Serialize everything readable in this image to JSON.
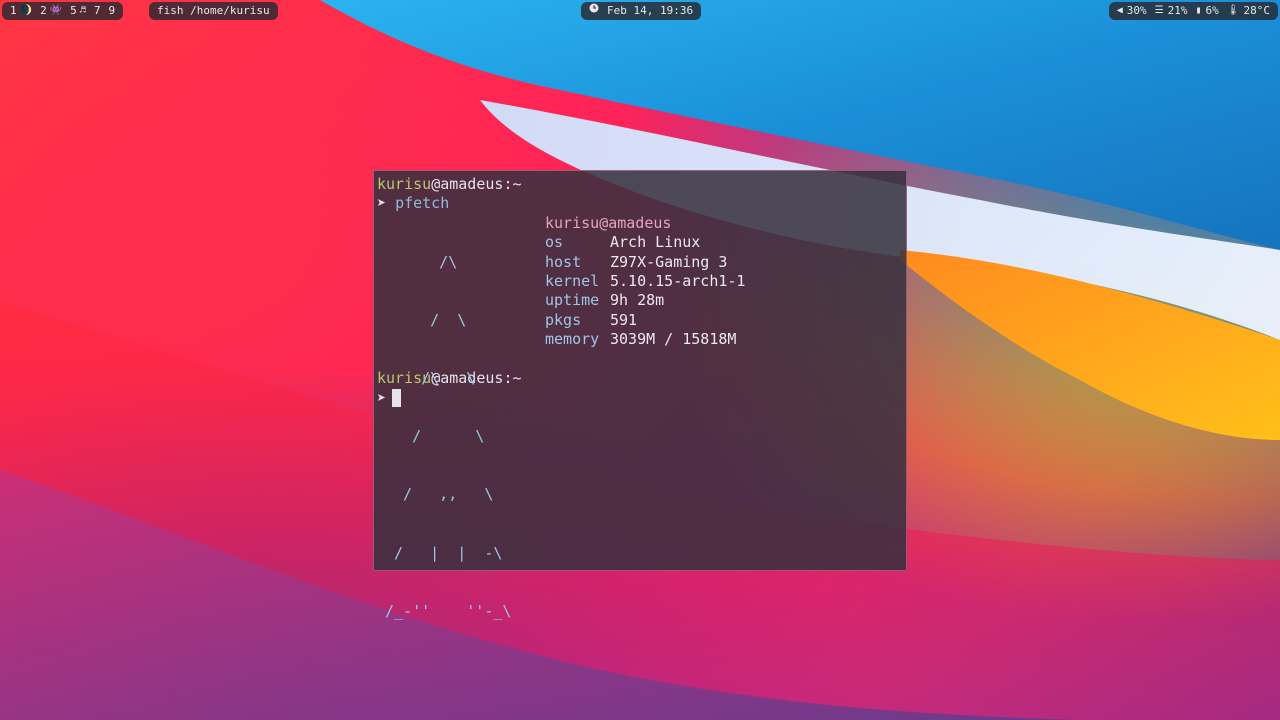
{
  "bar": {
    "workspaces": [
      {
        "num": "1",
        "icon": "firefox-icon",
        "glyph": "🌒"
      },
      {
        "num": "2",
        "icon": "reddit-icon",
        "glyph": "👾"
      },
      {
        "num": "5",
        "icon": "music-icon",
        "glyph": "♬"
      },
      {
        "num": "7",
        "icon": "",
        "glyph": ""
      },
      {
        "num": "9",
        "icon": "",
        "glyph": ""
      }
    ],
    "window_title": "fish /home/kurisu",
    "clock": {
      "icon": "clock-icon",
      "text": "Feb 14, 19:36"
    },
    "status": {
      "volume": {
        "icon": "volume-icon",
        "value": "30%"
      },
      "cpu": {
        "icon": "cpu-icon",
        "value": "21%"
      },
      "memory": {
        "icon": "memory-icon",
        "value": "6%"
      },
      "temperature": {
        "icon": "thermometer-icon",
        "value": "28°C"
      }
    }
  },
  "terminal": {
    "prompt1": {
      "user": "kurisu",
      "host": "@amadeus",
      "path": ":~"
    },
    "command": "pfetch",
    "ascii_art": [
      "      /\\",
      "     /  \\",
      "    /\\   \\",
      "   /      \\",
      "  /   ,,   \\",
      " /   |  |  -\\",
      "/_-''    ''-_\\"
    ],
    "fetch_header": {
      "user": "kurisu",
      "host": "@amadeus"
    },
    "fetch": [
      {
        "key": "os",
        "value": "Arch Linux"
      },
      {
        "key": "host",
        "value": "Z97X-Gaming 3"
      },
      {
        "key": "kernel",
        "value": "5.10.15-arch1-1"
      },
      {
        "key": "uptime",
        "value": "9h 28m"
      },
      {
        "key": "pkgs",
        "value": "591"
      },
      {
        "key": "memory",
        "value": "3039M / 15818M"
      }
    ],
    "prompt2": {
      "user": "kurisu",
      "host": "@amadeus",
      "path": ":~"
    },
    "prompt_arrow": "➤"
  },
  "colors": {
    "accent_user": "#b9c76a",
    "terminal_bg": "#36303e",
    "border": "#e678a0"
  }
}
